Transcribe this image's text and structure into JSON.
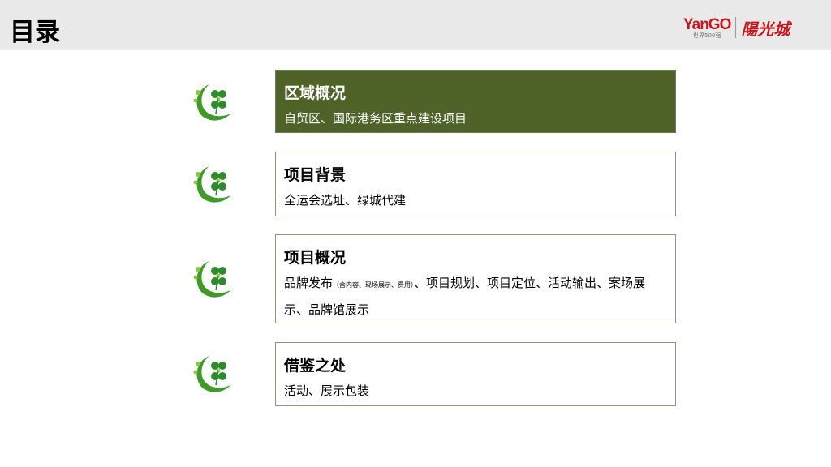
{
  "header": {
    "title": "目录",
    "logo": {
      "brand": "YanGO",
      "tagline": "世界500强",
      "chinese": "陽光城"
    }
  },
  "colors": {
    "accent": "#4f6228",
    "brand": "#c8161d"
  },
  "items": [
    {
      "title": "区域概况",
      "desc": "自贸区、国际港务区重点建设项目",
      "active": true
    },
    {
      "title": "项目背景",
      "desc": "全运会选址、绿城代建"
    },
    {
      "title": "项目概况",
      "desc_a": "品牌发布",
      "desc_note": "（含内容、现场展示、费用）",
      "desc_b": "、项目规划、项目定位、活动输出、案场展示、品牌馆展示"
    },
    {
      "title": "借鉴之处",
      "desc": "活动、展示包装"
    }
  ]
}
